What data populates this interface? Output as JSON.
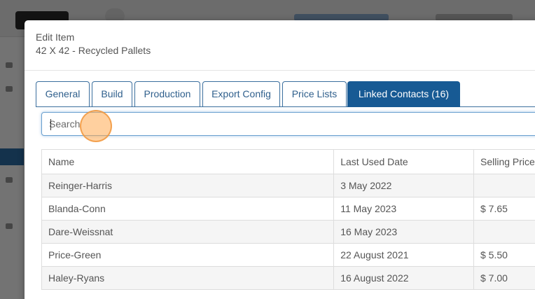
{
  "modal": {
    "heading": "Edit Item",
    "subheading": "42 X 42 - Recycled Pallets"
  },
  "tabs": [
    {
      "label": "General",
      "active": false
    },
    {
      "label": "Build",
      "active": false
    },
    {
      "label": "Production",
      "active": false
    },
    {
      "label": "Export Config",
      "active": false
    },
    {
      "label": "Price Lists",
      "active": false
    },
    {
      "label": "Linked Contacts (16)",
      "active": true
    }
  ],
  "search": {
    "placeholder": "Search",
    "value": ""
  },
  "table": {
    "columns": [
      "Name",
      "Last Used Date",
      "Selling Price"
    ],
    "rows": [
      {
        "name": "Reinger-Harris",
        "last_used": "3 May 2022",
        "price": ""
      },
      {
        "name": "Blanda-Conn",
        "last_used": "11 May 2023",
        "price": "$ 7.65"
      },
      {
        "name": "Dare-Weissnat",
        "last_used": "16 May 2023",
        "price": ""
      },
      {
        "name": "Price-Green",
        "last_used": "22 August 2021",
        "price": "$ 5.50"
      },
      {
        "name": "Haley-Ryans",
        "last_used": "16 August 2022",
        "price": "$ 7.00"
      }
    ]
  },
  "colors": {
    "accent": "#175a94",
    "tab_border": "#3b6f9e",
    "text": "#555555",
    "row_alt": "#f5f5f5"
  }
}
